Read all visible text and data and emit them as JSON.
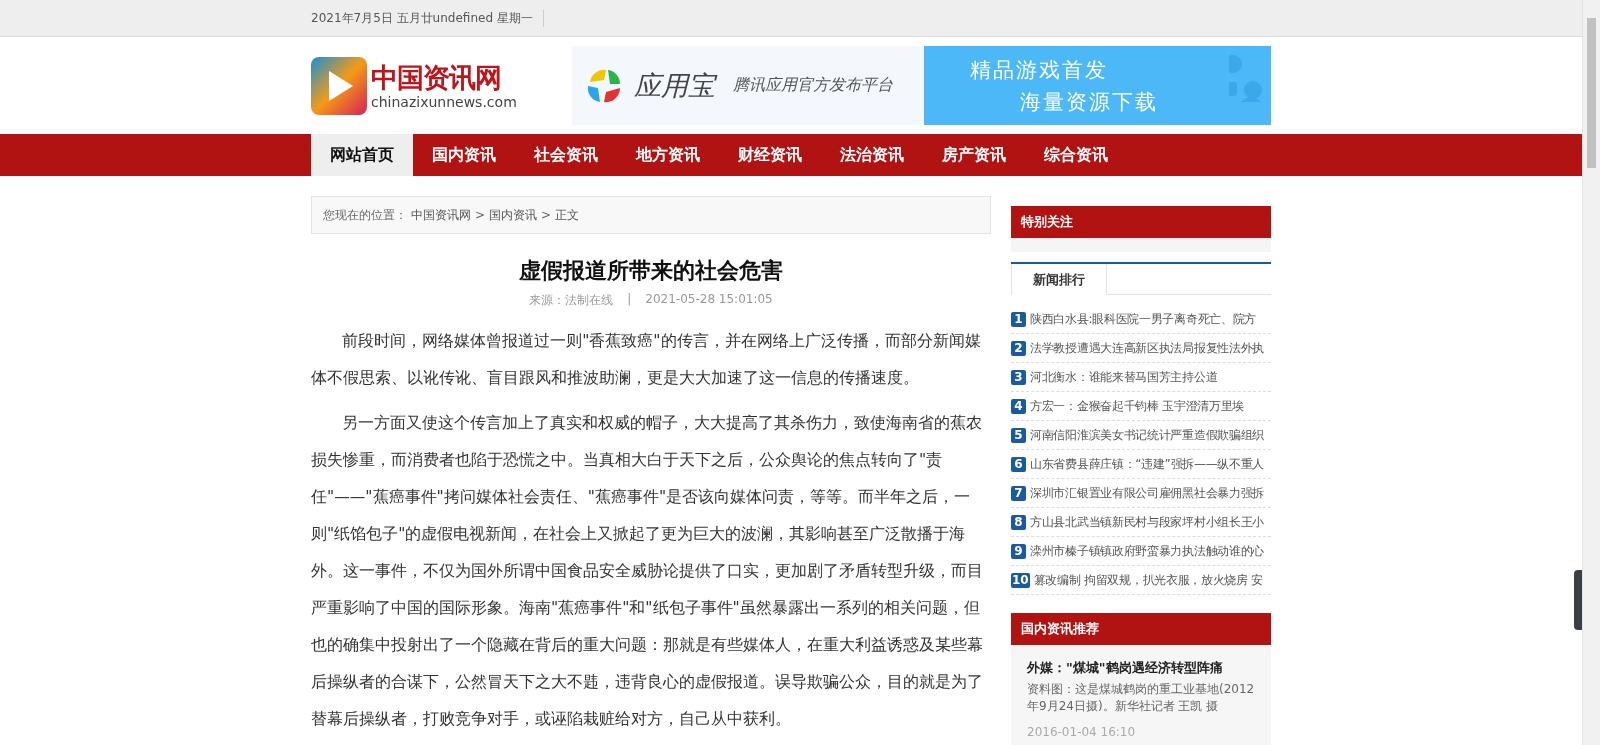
{
  "top_bar": {
    "date": "2021年7月5日 五月廿undefined 星期一"
  },
  "header": {
    "logo": {
      "name": "中国资讯网",
      "domain": "chinazixunnews.com"
    },
    "banner": {
      "brand": "应用宝",
      "tagline": "腾讯应用官方发布平台",
      "line_1": "精品游戏首发",
      "line_2": "海量资源下载"
    }
  },
  "nav": [
    {
      "label": "网站首页",
      "selected": true
    },
    {
      "label": "国内资讯",
      "selected": false
    },
    {
      "label": "社会资讯",
      "selected": false
    },
    {
      "label": "地方资讯",
      "selected": false
    },
    {
      "label": "财经资讯",
      "selected": false
    },
    {
      "label": "法治资讯",
      "selected": false
    },
    {
      "label": "房产资讯",
      "selected": false
    },
    {
      "label": "综合资讯",
      "selected": false
    }
  ],
  "breadcrumb": {
    "prefix": "您现在的位置：",
    "items": [
      {
        "kind": "link",
        "text": "中国资讯网"
      },
      {
        "kind": "separator",
        "text": ">"
      },
      {
        "kind": "link",
        "text": "国内资讯"
      },
      {
        "kind": "separator",
        "text": ">"
      },
      {
        "kind": "current",
        "text": "正文"
      }
    ]
  },
  "article": {
    "title": "虚假报道所带来的社会危害",
    "source": "来源：法制在线",
    "divider": "|",
    "date": "2021-05-28 15:01:05",
    "paragraphs": [
      "前段时间，网络媒体曾报道过一则\"香蕉致癌\"的传言，并在网络上广泛传播，而部分新闻媒体不假思索、以讹传讹、盲目跟风和推波助澜，更是大大加速了这一信息的传播速度。",
      "另一方面又使这个传言加上了真实和权威的帽子，大大提高了其杀伤力，致使海南省的蕉农损失惨重，而消费者也陷于恐慌之中。当真相大白于天下之后，公众舆论的焦点转向了\"责任\"——\"蕉癌事件\"拷问媒体社会责任、\"蕉癌事件\"是否该向媒体问责，等等。而半年之后，一则\"纸馅包子\"的虚假电视新闻，在社会上又掀起了更为巨大的波澜，其影响甚至广泛散播于海外。这一事件，不仅为国外所谓中国食品安全威胁论提供了口实，更加剧了矛盾转型升级，而目严重影响了中国的国际形象。海南\"蕉癌事件\"和\"纸包子事件\"虽然暴露出一系列的相关问题，但也的确集中投射出了一个隐藏在背后的重大问题：那就是有些媒体人，在重大利益诱惑及某些幕后操纵者的合谋下，公然冒天下之大不韪，违背良心的虚假报道。误导欺骗公众，目的就是为了替幕后操纵者，打败竞争对手，或诬陷栽赃给对方，自己从中获利。"
    ]
  },
  "sidebar": {
    "special": {
      "title": "特别关注"
    },
    "tabs": [
      {
        "label": "新闻排行",
        "selected": true
      }
    ],
    "ranking": [
      {
        "rank": "1",
        "title": "陕西白水县:眼科医院一男子离奇死亡、院方"
      },
      {
        "rank": "2",
        "title": "法学教授遭遇大连高新区执法局报复性法外执"
      },
      {
        "rank": "3",
        "title": "河北衡水：谁能来替马国芳主持公道"
      },
      {
        "rank": "4",
        "title": "方宏一：金猴奋起千钧棒 玉宇澄清万里埃"
      },
      {
        "rank": "5",
        "title": "河南信阳淮滨美女书记统计严重造假欺骗组织"
      },
      {
        "rank": "6",
        "title": "山东省费县薛庄镇：“违建”强拆——纵不重人"
      },
      {
        "rank": "7",
        "title": "深圳市汇银置业有限公司雇佣黑社会暴力强拆"
      },
      {
        "rank": "8",
        "title": "方山县北武当镇新民村与段家坪村小组长王小"
      },
      {
        "rank": "9",
        "title": "滦州市榛子镇镇政府野蛮暴力执法触动谁的心"
      },
      {
        "rank": "10",
        "title": "篡改编制 拘留双规，扒光衣服，放火烧房 安"
      }
    ],
    "recommend": {
      "title": "国内资讯推荐",
      "item": {
        "title": "外媒：\"煤城\"鹤岗遇经济转型阵痛",
        "summary": "资料图：这是煤城鹤岗的重工业基地(2012年9月24日摄)。新华社记者 王凯 摄",
        "date": "2016-01-04 16:10"
      }
    }
  }
}
